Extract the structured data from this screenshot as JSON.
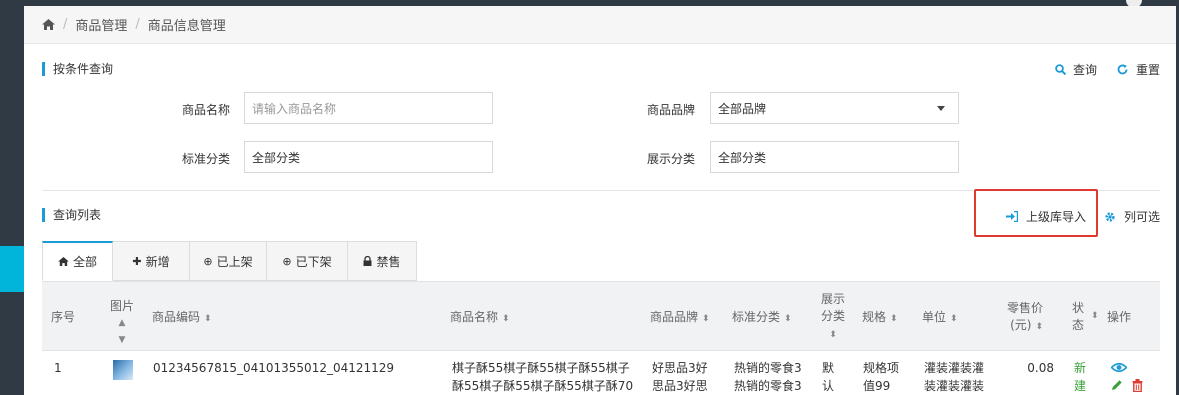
{
  "breadcrumb": {
    "items": [
      "商品管理",
      "商品信息管理"
    ],
    "home_icon": "home-icon"
  },
  "query_section": {
    "title": "按条件查询",
    "search_label": "查询",
    "reset_label": "重置",
    "fields": {
      "name_label": "商品名称",
      "name_placeholder": "请输入商品名称",
      "brand_label": "商品品牌",
      "brand_value": "全部品牌",
      "std_cat_label": "标准分类",
      "std_cat_value": "全部分类",
      "disp_cat_label": "展示分类",
      "disp_cat_value": "全部分类"
    }
  },
  "list_section": {
    "title": "查询列表",
    "import_label": "上级库导入",
    "columns_label": "列可选"
  },
  "tabs": [
    {
      "label": "全部",
      "icon": "home-icon"
    },
    {
      "label": "新增",
      "icon": "plus-icon"
    },
    {
      "label": "已上架",
      "icon": "up-circle-icon"
    },
    {
      "label": "已下架",
      "icon": "down-circle-icon"
    },
    {
      "label": "禁售",
      "icon": "lock-icon"
    }
  ],
  "table": {
    "headers": {
      "seq": "序号",
      "image_l1": "图片",
      "code": "商品编码",
      "name": "商品名称",
      "brand": "商品品牌",
      "std_cat": "标准分类",
      "disp_cat_l1": "展示",
      "disp_cat_l2": "分类",
      "spec": "规格",
      "unit": "单位",
      "price_l1": "零售价",
      "price_l2": "(元)",
      "status_l1": "状",
      "status_l2": "态",
      "ops": "操作"
    },
    "rows": [
      {
        "seq": "1",
        "code": "01234567815_04101355012_04121129",
        "name_l1": "棋子酥55棋子酥55棋子酥55棋子",
        "name_l2": "酥55棋子酥55棋子酥55棋子酥70",
        "brand_l1": "好思品3好",
        "brand_l2": "思品3好思",
        "std_cat_l1": "热销的零食3",
        "std_cat_l2": "热销的零食3",
        "disp_cat_l1": "默",
        "disp_cat_l2": "认",
        "spec_l1": "规格项",
        "spec_l2": "值99",
        "unit_l1": "灌装灌装灌",
        "unit_l2": "装灌装灌装",
        "price": "0.08",
        "status_l1": "新",
        "status_l2": "建"
      }
    ]
  },
  "colors": {
    "accent": "#1c9bd8",
    "highlight": "#e03a30",
    "status_new": "#3aa13a",
    "delete": "#e03a30"
  }
}
